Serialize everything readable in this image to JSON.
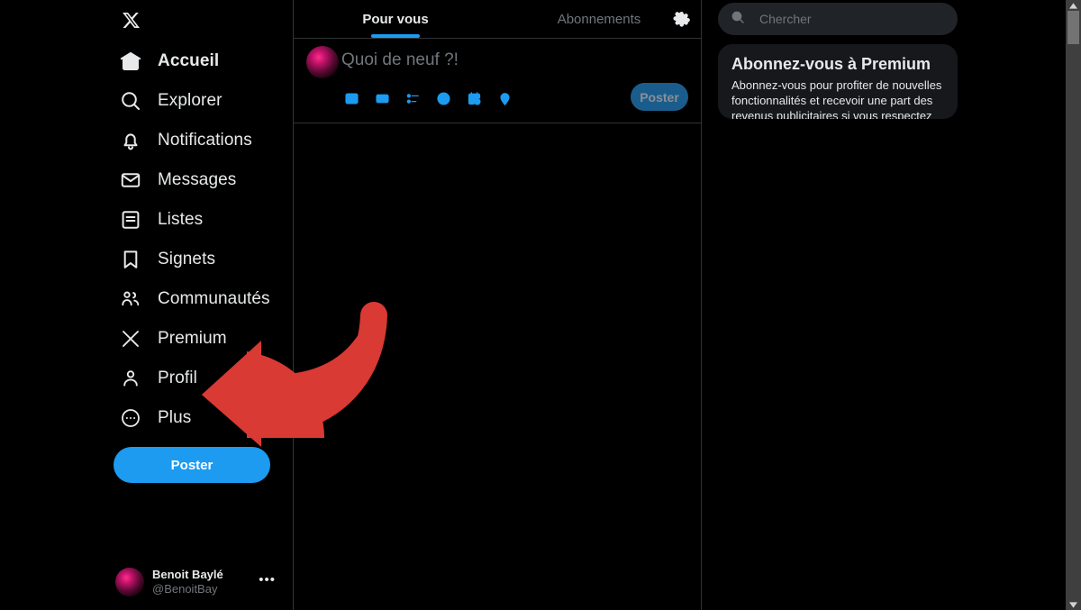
{
  "app": {
    "name": "X (Twitter) web client",
    "background_color": "#000000",
    "accent_color": "#1d9bf0",
    "annotation_color": "#d93a33"
  },
  "sidebar": {
    "logo_icon": "x-logo-icon",
    "items": [
      {
        "label": "Accueil",
        "icon": "home-icon",
        "active": true
      },
      {
        "label": "Explorer",
        "icon": "search-icon",
        "active": false
      },
      {
        "label": "Notifications",
        "icon": "bell-icon",
        "active": false
      },
      {
        "label": "Messages",
        "icon": "envelope-icon",
        "active": false
      },
      {
        "label": "Listes",
        "icon": "list-icon",
        "active": false
      },
      {
        "label": "Signets",
        "icon": "bookmark-icon",
        "active": false
      },
      {
        "label": "Communautés",
        "icon": "communities-icon",
        "active": false
      },
      {
        "label": "Premium",
        "icon": "x-logo-icon",
        "active": false
      },
      {
        "label": "Profil",
        "icon": "person-icon",
        "active": false
      },
      {
        "label": "Plus",
        "icon": "more-circle-icon",
        "active": false
      }
    ],
    "post_button_label": "Poster",
    "account": {
      "display_name": "Benoit Baylé",
      "handle": "@BenoitBay",
      "more_glyph": "•••",
      "avatar_icon": "user-avatar"
    }
  },
  "main": {
    "tabs": [
      {
        "label": "Pour vous",
        "active": true
      },
      {
        "label": "Abonnements",
        "active": false
      }
    ],
    "settings_icon": "gear-icon",
    "composer": {
      "avatar_icon": "user-avatar",
      "placeholder": "Quoi de neuf ?!",
      "value": "",
      "tools": [
        {
          "icon": "image-icon"
        },
        {
          "icon": "gif-icon"
        },
        {
          "icon": "poll-icon"
        },
        {
          "icon": "emoji-icon"
        },
        {
          "icon": "schedule-icon"
        },
        {
          "icon": "location-icon"
        }
      ],
      "post_button_label": "Poster",
      "post_button_disabled": true
    }
  },
  "right": {
    "search": {
      "icon": "search-icon",
      "placeholder": "Chercher",
      "value": ""
    },
    "premium_card": {
      "title": "Abonnez-vous à Premium",
      "body": "Abonnez-vous pour profiter de nouvelles fonctionnalités et recevoir une part des revenus publicitaires si vous respectez les"
    }
  },
  "scrollbar": {
    "up_arrow_icon": "caret-up-icon",
    "down_arrow_icon": "caret-down-icon",
    "thumb_position_percent": 2
  },
  "annotation": {
    "type": "curved-arrow-left",
    "color": "#d93a33",
    "points_to": "Poster"
  }
}
